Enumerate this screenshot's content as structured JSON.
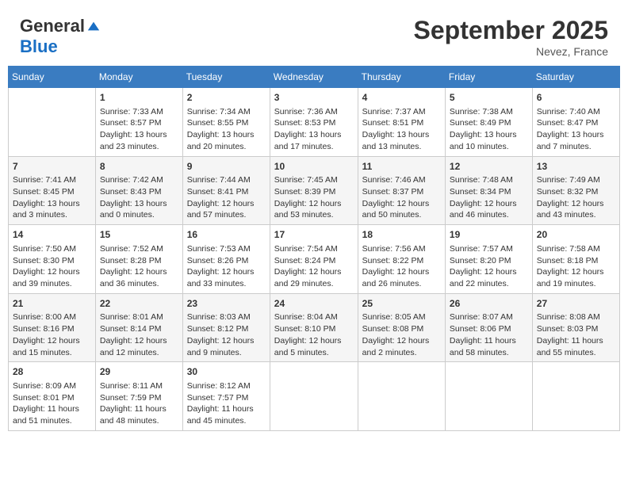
{
  "header": {
    "logo_general": "General",
    "logo_blue": "Blue",
    "month_title": "September 2025",
    "location": "Nevez, France"
  },
  "weekdays": [
    "Sunday",
    "Monday",
    "Tuesday",
    "Wednesday",
    "Thursday",
    "Friday",
    "Saturday"
  ],
  "weeks": [
    [
      {
        "day": "",
        "sunrise": "",
        "sunset": "",
        "daylight": ""
      },
      {
        "day": "1",
        "sunrise": "Sunrise: 7:33 AM",
        "sunset": "Sunset: 8:57 PM",
        "daylight": "Daylight: 13 hours and 23 minutes."
      },
      {
        "day": "2",
        "sunrise": "Sunrise: 7:34 AM",
        "sunset": "Sunset: 8:55 PM",
        "daylight": "Daylight: 13 hours and 20 minutes."
      },
      {
        "day": "3",
        "sunrise": "Sunrise: 7:36 AM",
        "sunset": "Sunset: 8:53 PM",
        "daylight": "Daylight: 13 hours and 17 minutes."
      },
      {
        "day": "4",
        "sunrise": "Sunrise: 7:37 AM",
        "sunset": "Sunset: 8:51 PM",
        "daylight": "Daylight: 13 hours and 13 minutes."
      },
      {
        "day": "5",
        "sunrise": "Sunrise: 7:38 AM",
        "sunset": "Sunset: 8:49 PM",
        "daylight": "Daylight: 13 hours and 10 minutes."
      },
      {
        "day": "6",
        "sunrise": "Sunrise: 7:40 AM",
        "sunset": "Sunset: 8:47 PM",
        "daylight": "Daylight: 13 hours and 7 minutes."
      }
    ],
    [
      {
        "day": "7",
        "sunrise": "Sunrise: 7:41 AM",
        "sunset": "Sunset: 8:45 PM",
        "daylight": "Daylight: 13 hours and 3 minutes."
      },
      {
        "day": "8",
        "sunrise": "Sunrise: 7:42 AM",
        "sunset": "Sunset: 8:43 PM",
        "daylight": "Daylight: 13 hours and 0 minutes."
      },
      {
        "day": "9",
        "sunrise": "Sunrise: 7:44 AM",
        "sunset": "Sunset: 8:41 PM",
        "daylight": "Daylight: 12 hours and 57 minutes."
      },
      {
        "day": "10",
        "sunrise": "Sunrise: 7:45 AM",
        "sunset": "Sunset: 8:39 PM",
        "daylight": "Daylight: 12 hours and 53 minutes."
      },
      {
        "day": "11",
        "sunrise": "Sunrise: 7:46 AM",
        "sunset": "Sunset: 8:37 PM",
        "daylight": "Daylight: 12 hours and 50 minutes."
      },
      {
        "day": "12",
        "sunrise": "Sunrise: 7:48 AM",
        "sunset": "Sunset: 8:34 PM",
        "daylight": "Daylight: 12 hours and 46 minutes."
      },
      {
        "day": "13",
        "sunrise": "Sunrise: 7:49 AM",
        "sunset": "Sunset: 8:32 PM",
        "daylight": "Daylight: 12 hours and 43 minutes."
      }
    ],
    [
      {
        "day": "14",
        "sunrise": "Sunrise: 7:50 AM",
        "sunset": "Sunset: 8:30 PM",
        "daylight": "Daylight: 12 hours and 39 minutes."
      },
      {
        "day": "15",
        "sunrise": "Sunrise: 7:52 AM",
        "sunset": "Sunset: 8:28 PM",
        "daylight": "Daylight: 12 hours and 36 minutes."
      },
      {
        "day": "16",
        "sunrise": "Sunrise: 7:53 AM",
        "sunset": "Sunset: 8:26 PM",
        "daylight": "Daylight: 12 hours and 33 minutes."
      },
      {
        "day": "17",
        "sunrise": "Sunrise: 7:54 AM",
        "sunset": "Sunset: 8:24 PM",
        "daylight": "Daylight: 12 hours and 29 minutes."
      },
      {
        "day": "18",
        "sunrise": "Sunrise: 7:56 AM",
        "sunset": "Sunset: 8:22 PM",
        "daylight": "Daylight: 12 hours and 26 minutes."
      },
      {
        "day": "19",
        "sunrise": "Sunrise: 7:57 AM",
        "sunset": "Sunset: 8:20 PM",
        "daylight": "Daylight: 12 hours and 22 minutes."
      },
      {
        "day": "20",
        "sunrise": "Sunrise: 7:58 AM",
        "sunset": "Sunset: 8:18 PM",
        "daylight": "Daylight: 12 hours and 19 minutes."
      }
    ],
    [
      {
        "day": "21",
        "sunrise": "Sunrise: 8:00 AM",
        "sunset": "Sunset: 8:16 PM",
        "daylight": "Daylight: 12 hours and 15 minutes."
      },
      {
        "day": "22",
        "sunrise": "Sunrise: 8:01 AM",
        "sunset": "Sunset: 8:14 PM",
        "daylight": "Daylight: 12 hours and 12 minutes."
      },
      {
        "day": "23",
        "sunrise": "Sunrise: 8:03 AM",
        "sunset": "Sunset: 8:12 PM",
        "daylight": "Daylight: 12 hours and 9 minutes."
      },
      {
        "day": "24",
        "sunrise": "Sunrise: 8:04 AM",
        "sunset": "Sunset: 8:10 PM",
        "daylight": "Daylight: 12 hours and 5 minutes."
      },
      {
        "day": "25",
        "sunrise": "Sunrise: 8:05 AM",
        "sunset": "Sunset: 8:08 PM",
        "daylight": "Daylight: 12 hours and 2 minutes."
      },
      {
        "day": "26",
        "sunrise": "Sunrise: 8:07 AM",
        "sunset": "Sunset: 8:06 PM",
        "daylight": "Daylight: 11 hours and 58 minutes."
      },
      {
        "day": "27",
        "sunrise": "Sunrise: 8:08 AM",
        "sunset": "Sunset: 8:03 PM",
        "daylight": "Daylight: 11 hours and 55 minutes."
      }
    ],
    [
      {
        "day": "28",
        "sunrise": "Sunrise: 8:09 AM",
        "sunset": "Sunset: 8:01 PM",
        "daylight": "Daylight: 11 hours and 51 minutes."
      },
      {
        "day": "29",
        "sunrise": "Sunrise: 8:11 AM",
        "sunset": "Sunset: 7:59 PM",
        "daylight": "Daylight: 11 hours and 48 minutes."
      },
      {
        "day": "30",
        "sunrise": "Sunrise: 8:12 AM",
        "sunset": "Sunset: 7:57 PM",
        "daylight": "Daylight: 11 hours and 45 minutes."
      },
      {
        "day": "",
        "sunrise": "",
        "sunset": "",
        "daylight": ""
      },
      {
        "day": "",
        "sunrise": "",
        "sunset": "",
        "daylight": ""
      },
      {
        "day": "",
        "sunrise": "",
        "sunset": "",
        "daylight": ""
      },
      {
        "day": "",
        "sunrise": "",
        "sunset": "",
        "daylight": ""
      }
    ]
  ]
}
